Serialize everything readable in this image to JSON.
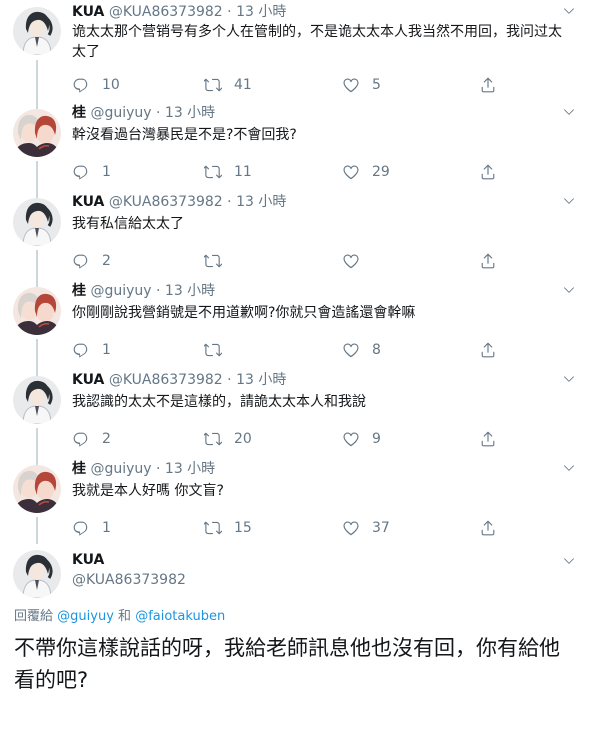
{
  "tweets": [
    {
      "name": "KUA",
      "handle": "@KUA86373982",
      "dot": "·",
      "time": "13 小時",
      "text": "诡太太那个营销号有多个人在管制的，不是诡太太本人我当然不用回，我问过太太了",
      "replies": "10",
      "retweets": "41",
      "likes": "5",
      "avatar_icon": "avatar-dark-hair-white-shirt"
    },
    {
      "name": "桂",
      "handle": "@guiyuy",
      "dot": "·",
      "time": "13 小時",
      "text": "幹沒看過台灣暴民是不是?不會回我?",
      "replies": "1",
      "retweets": "11",
      "likes": "29",
      "avatar_icon": "avatar-two-anime-characters"
    },
    {
      "name": "KUA",
      "handle": "@KUA86373982",
      "dot": "·",
      "time": "13 小時",
      "text": "我有私信給太太了",
      "replies": "2",
      "retweets": "",
      "likes": "",
      "avatar_icon": "avatar-dark-hair-white-shirt"
    },
    {
      "name": "桂",
      "handle": "@guiyuy",
      "dot": "·",
      "time": "13 小時",
      "text": "你剛剛說我營銷號是不用道歉啊?你就只會造謠還會幹嘛",
      "replies": "1",
      "retweets": "",
      "likes": "8",
      "avatar_icon": "avatar-two-anime-characters"
    },
    {
      "name": "KUA",
      "handle": "@KUA86373982",
      "dot": "·",
      "time": "13 小時",
      "text": "我認識的太太不是這樣的，請詭太太本人和我說",
      "replies": "2",
      "retweets": "20",
      "likes": "9",
      "avatar_icon": "avatar-dark-hair-white-shirt"
    },
    {
      "name": "桂",
      "handle": "@guiyuy",
      "dot": "·",
      "time": "13 小時",
      "text": "我就是本人好嗎 你文盲?",
      "replies": "1",
      "retweets": "15",
      "likes": "37",
      "avatar_icon": "avatar-two-anime-characters"
    }
  ],
  "main": {
    "name": "KUA",
    "handle": "@KUA86373982",
    "replying_prefix": "回覆給",
    "replying_user1": "@guiyuy",
    "replying_and": "和",
    "replying_user2": "@faiotakuben",
    "text": "不帶你這樣說話的呀，我給老師訊息他也沒有回，你有給他看的吧?"
  },
  "colors": {
    "text": "#14171a",
    "secondary": "#657786",
    "link": "#1b95e0",
    "thread_line": "#ccd6dd",
    "separator": "#e6ecf0"
  },
  "icons": {
    "reply": "reply-icon",
    "retweet": "retweet-icon",
    "like": "heart-icon",
    "share": "share-icon",
    "menu": "chevron-down-icon"
  }
}
